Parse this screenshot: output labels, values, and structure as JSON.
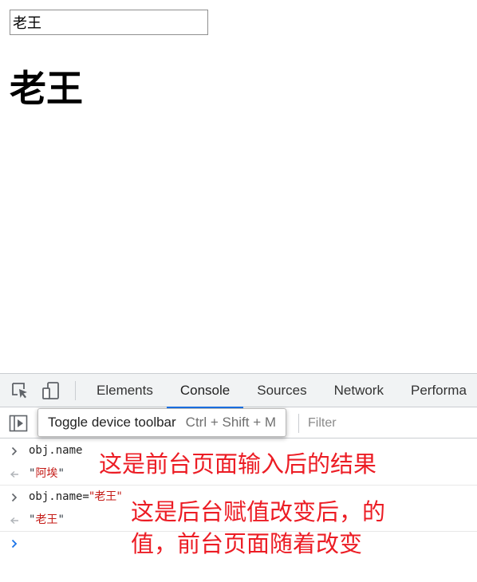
{
  "page": {
    "input_value": "老王",
    "heading": "老王"
  },
  "devtools": {
    "tabs": [
      {
        "label": "Elements",
        "active": false
      },
      {
        "label": "Console",
        "active": true
      },
      {
        "label": "Sources",
        "active": false
      },
      {
        "label": "Network",
        "active": false
      },
      {
        "label": "Performa",
        "active": false
      }
    ],
    "filter_placeholder": "Filter",
    "tooltip": {
      "title": "Toggle device toolbar",
      "shortcut": "Ctrl + Shift + M"
    },
    "accent_color": "#1a73e8"
  },
  "console": {
    "entries": [
      {
        "command": "obj.name",
        "result": "阿埃"
      },
      {
        "command_prefix": "obj.name=",
        "command_value": "老王",
        "result": "老王"
      }
    ]
  },
  "annotations": {
    "first": "这是前台页面输入后的结果",
    "second_line1": "这是后台赋值改变后，的",
    "second_line2": "值，前台页面随着改变",
    "color": "#ec1c24"
  }
}
